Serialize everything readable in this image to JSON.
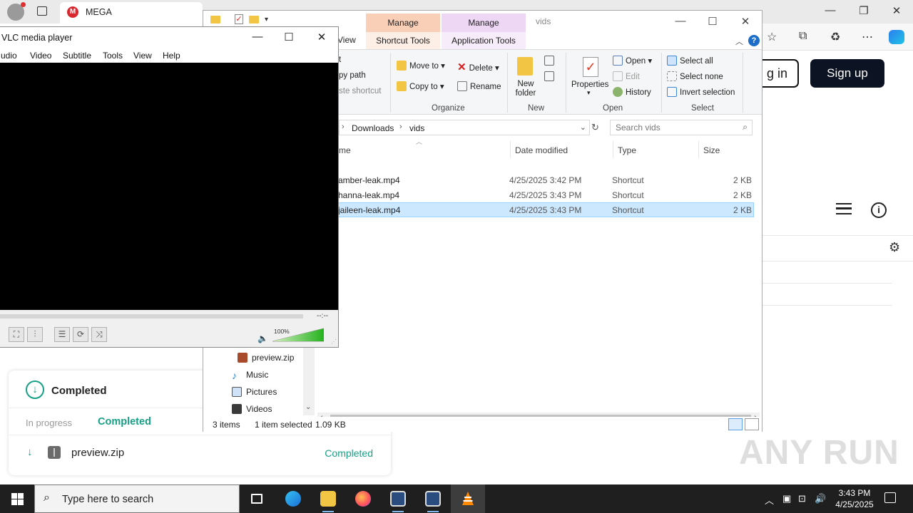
{
  "browser": {
    "tab_title": "MEGA",
    "tab_favicon": "M",
    "window_controls": [
      "—",
      "❐",
      "✕"
    ],
    "toolbar_icons": [
      "star-add-icon",
      "collections-icon",
      "extensions-icon",
      "more-icon",
      "copilot-icon"
    ],
    "login_label": "g in",
    "signup_label": "Sign up"
  },
  "downloads": {
    "heading": "Completed",
    "tab_in_progress": "In progress",
    "tab_completed": "Completed",
    "items": [
      {
        "name": "preview.zip",
        "status": "Completed"
      }
    ]
  },
  "watermark": "ANY RUN",
  "explorer": {
    "title": "vids",
    "context_tabs": [
      {
        "label": "Manage",
        "group": "Shortcut Tools",
        "color": "#f9cfb8"
      },
      {
        "label": "Manage",
        "group": "Application Tools",
        "color": "#eed6f5"
      }
    ],
    "ribbon_tabs": [
      "View"
    ],
    "ribbon": {
      "clipboard": {
        "items": [
          "t",
          "py path",
          "ste shortcut"
        ]
      },
      "organize": {
        "label": "Organize",
        "move_to": "Move to",
        "copy_to": "Copy to",
        "delete": "Delete",
        "rename": "Rename"
      },
      "new": {
        "label": "New",
        "new_folder": "New folder"
      },
      "open": {
        "label": "Open",
        "properties": "Properties",
        "open": "Open",
        "edit": "Edit",
        "history": "History"
      },
      "select": {
        "label": "Select",
        "select_all": "Select all",
        "select_none": "Select none",
        "invert": "Invert selection"
      }
    },
    "breadcrumb": [
      "Downloads",
      "vids"
    ],
    "search_placeholder": "Search vids",
    "nav_items": [
      {
        "label": "preview.zip",
        "icon": "zip-icon"
      },
      {
        "label": "Music",
        "icon": "music-icon"
      },
      {
        "label": "Pictures",
        "icon": "pictures-icon"
      },
      {
        "label": "Videos",
        "icon": "videos-icon"
      }
    ],
    "columns": {
      "name": "me",
      "date": "Date modified",
      "type": "Type",
      "size": "Size"
    },
    "files": [
      {
        "name": "amber-leak.mp4",
        "date": "4/25/2025 3:42 PM",
        "type": "Shortcut",
        "size": "2 KB",
        "selected": false
      },
      {
        "name": "hanna-leak.mp4",
        "date": "4/25/2025 3:43 PM",
        "type": "Shortcut",
        "size": "2 KB",
        "selected": false
      },
      {
        "name": "jaileen-leak.mp4",
        "date": "4/25/2025 3:43 PM",
        "type": "Shortcut",
        "size": "2 KB",
        "selected": true
      }
    ],
    "status": {
      "count": "3 items",
      "selected": "1 item selected",
      "size": "1.09 KB"
    }
  },
  "vlc": {
    "title": "VLC media player",
    "menu": [
      "udio",
      "Video",
      "Subtitle",
      "Tools",
      "View",
      "Help"
    ],
    "timecode": "--:--",
    "volume": "100%",
    "volume_level": 1.0
  },
  "taskbar": {
    "search_placeholder": "Type here to search",
    "apps": [
      "task-view-icon",
      "edge-icon",
      "file-explorer-icon",
      "firefox-icon",
      "video-app-icon",
      "video-app-icon",
      "vlc-icon"
    ],
    "time": "3:43 PM",
    "date": "4/25/2025"
  }
}
